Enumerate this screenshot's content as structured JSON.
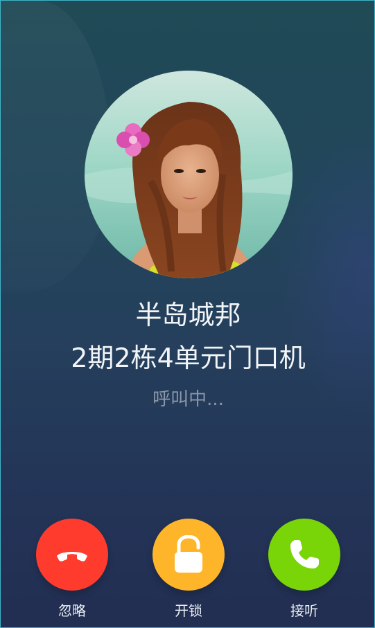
{
  "caller": {
    "name": "半岛城邦",
    "device": "2期2栋4单元门口机",
    "status": "呼叫中..."
  },
  "actions": [
    {
      "id": "ignore",
      "label": "忽略",
      "icon": "hang-up-icon",
      "color": "#ff3b2e"
    },
    {
      "id": "unlock",
      "label": "开锁",
      "icon": "unlock-icon",
      "color": "#ffb52a"
    },
    {
      "id": "answer",
      "label": "接听",
      "icon": "phone-icon",
      "color": "#79d508"
    }
  ],
  "avatar": {
    "icon": "caller-avatar-photo"
  },
  "colors": {
    "background_top": "#1f4a56",
    "background_bottom": "#222e52",
    "primary_text": "#f2f5f7",
    "secondary_text": "#8a97a8"
  }
}
